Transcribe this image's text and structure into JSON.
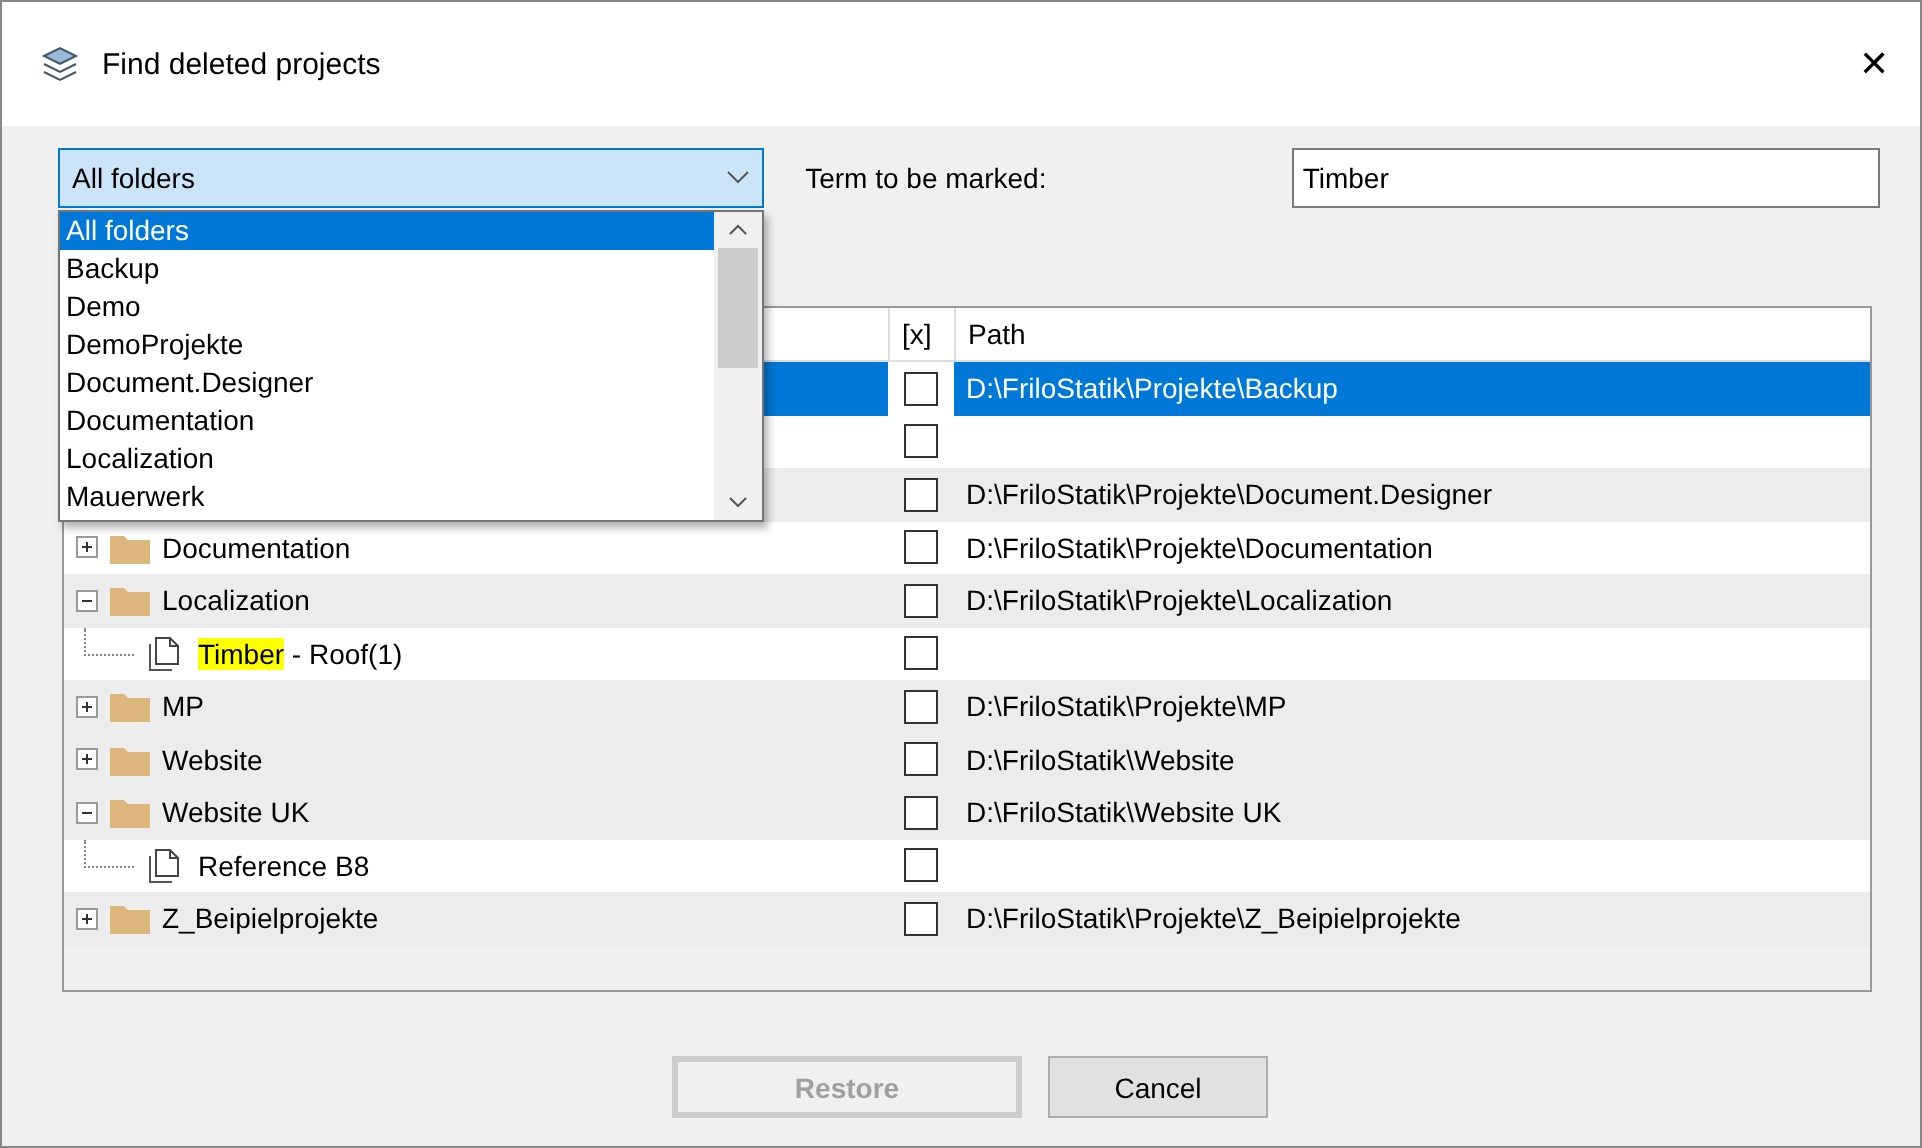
{
  "window": {
    "title": "Find deleted projects",
    "close": "✕"
  },
  "folder_combo": {
    "value": "All folders",
    "open": true,
    "options": [
      {
        "label": "All folders",
        "selected": true
      },
      {
        "label": "Backup",
        "selected": false
      },
      {
        "label": "Demo",
        "selected": false
      },
      {
        "label": "DemoProjekte",
        "selected": false
      },
      {
        "label": "Document.Designer",
        "selected": false
      },
      {
        "label": "Documentation",
        "selected": false
      },
      {
        "label": "Localization",
        "selected": false
      },
      {
        "label": "Mauerwerk",
        "selected": false
      }
    ]
  },
  "term": {
    "label": "Term to be marked:",
    "value": "Timber"
  },
  "table": {
    "columns": {
      "check": "[x]",
      "path": "Path"
    },
    "rows": [
      {
        "selected": true,
        "shaded": false,
        "checked": false,
        "path": "D:\\FriloStatik\\Projekte\\Backup"
      },
      {
        "selected": false,
        "shaded": false,
        "checked": false
      },
      {
        "selected": false,
        "shaded": true,
        "checked": false,
        "path": "D:\\FriloStatik\\Projekte\\Document.Designer"
      },
      {
        "kind": "folder",
        "expanded": false,
        "name": "Documentation",
        "selected": false,
        "shaded": false,
        "checked": false,
        "path": "D:\\FriloStatik\\Projekte\\Documentation"
      },
      {
        "kind": "folder",
        "expanded": true,
        "name": "Localization",
        "selected": false,
        "shaded": true,
        "checked": false,
        "path": "D:\\FriloStatik\\Projekte\\Localization",
        "children": [
          {
            "kind": "file",
            "marked": "Timber",
            "name": " - Roof(1)",
            "selected": false,
            "shaded": false,
            "checked": false
          }
        ]
      },
      {
        "kind": "folder",
        "expanded": false,
        "name": "MP",
        "selected": false,
        "shaded": true,
        "checked": false,
        "path": "D:\\FriloStatik\\Projekte\\MP"
      },
      {
        "kind": "folder",
        "expanded": false,
        "name": "Website",
        "selected": false,
        "shaded": true,
        "checked": false,
        "path": "D:\\FriloStatik\\Website"
      },
      {
        "kind": "folder",
        "expanded": true,
        "name": "Website UK",
        "selected": false,
        "shaded": true,
        "checked": false,
        "path": "D:\\FriloStatik\\Website UK",
        "children": [
          {
            "kind": "file",
            "name": "Reference B8",
            "selected": false,
            "shaded": false,
            "checked": false
          }
        ]
      },
      {
        "kind": "folder",
        "expanded": false,
        "name": "Z_Beipielprojekte",
        "selected": false,
        "shaded": true,
        "checked": false,
        "path": "D:\\FriloStatik\\Projekte\\Z_Beipielprojekte"
      }
    ]
  },
  "buttons": [
    {
      "label": "Restore",
      "disabled": true
    },
    {
      "label": "Cancel",
      "disabled": false
    }
  ]
}
